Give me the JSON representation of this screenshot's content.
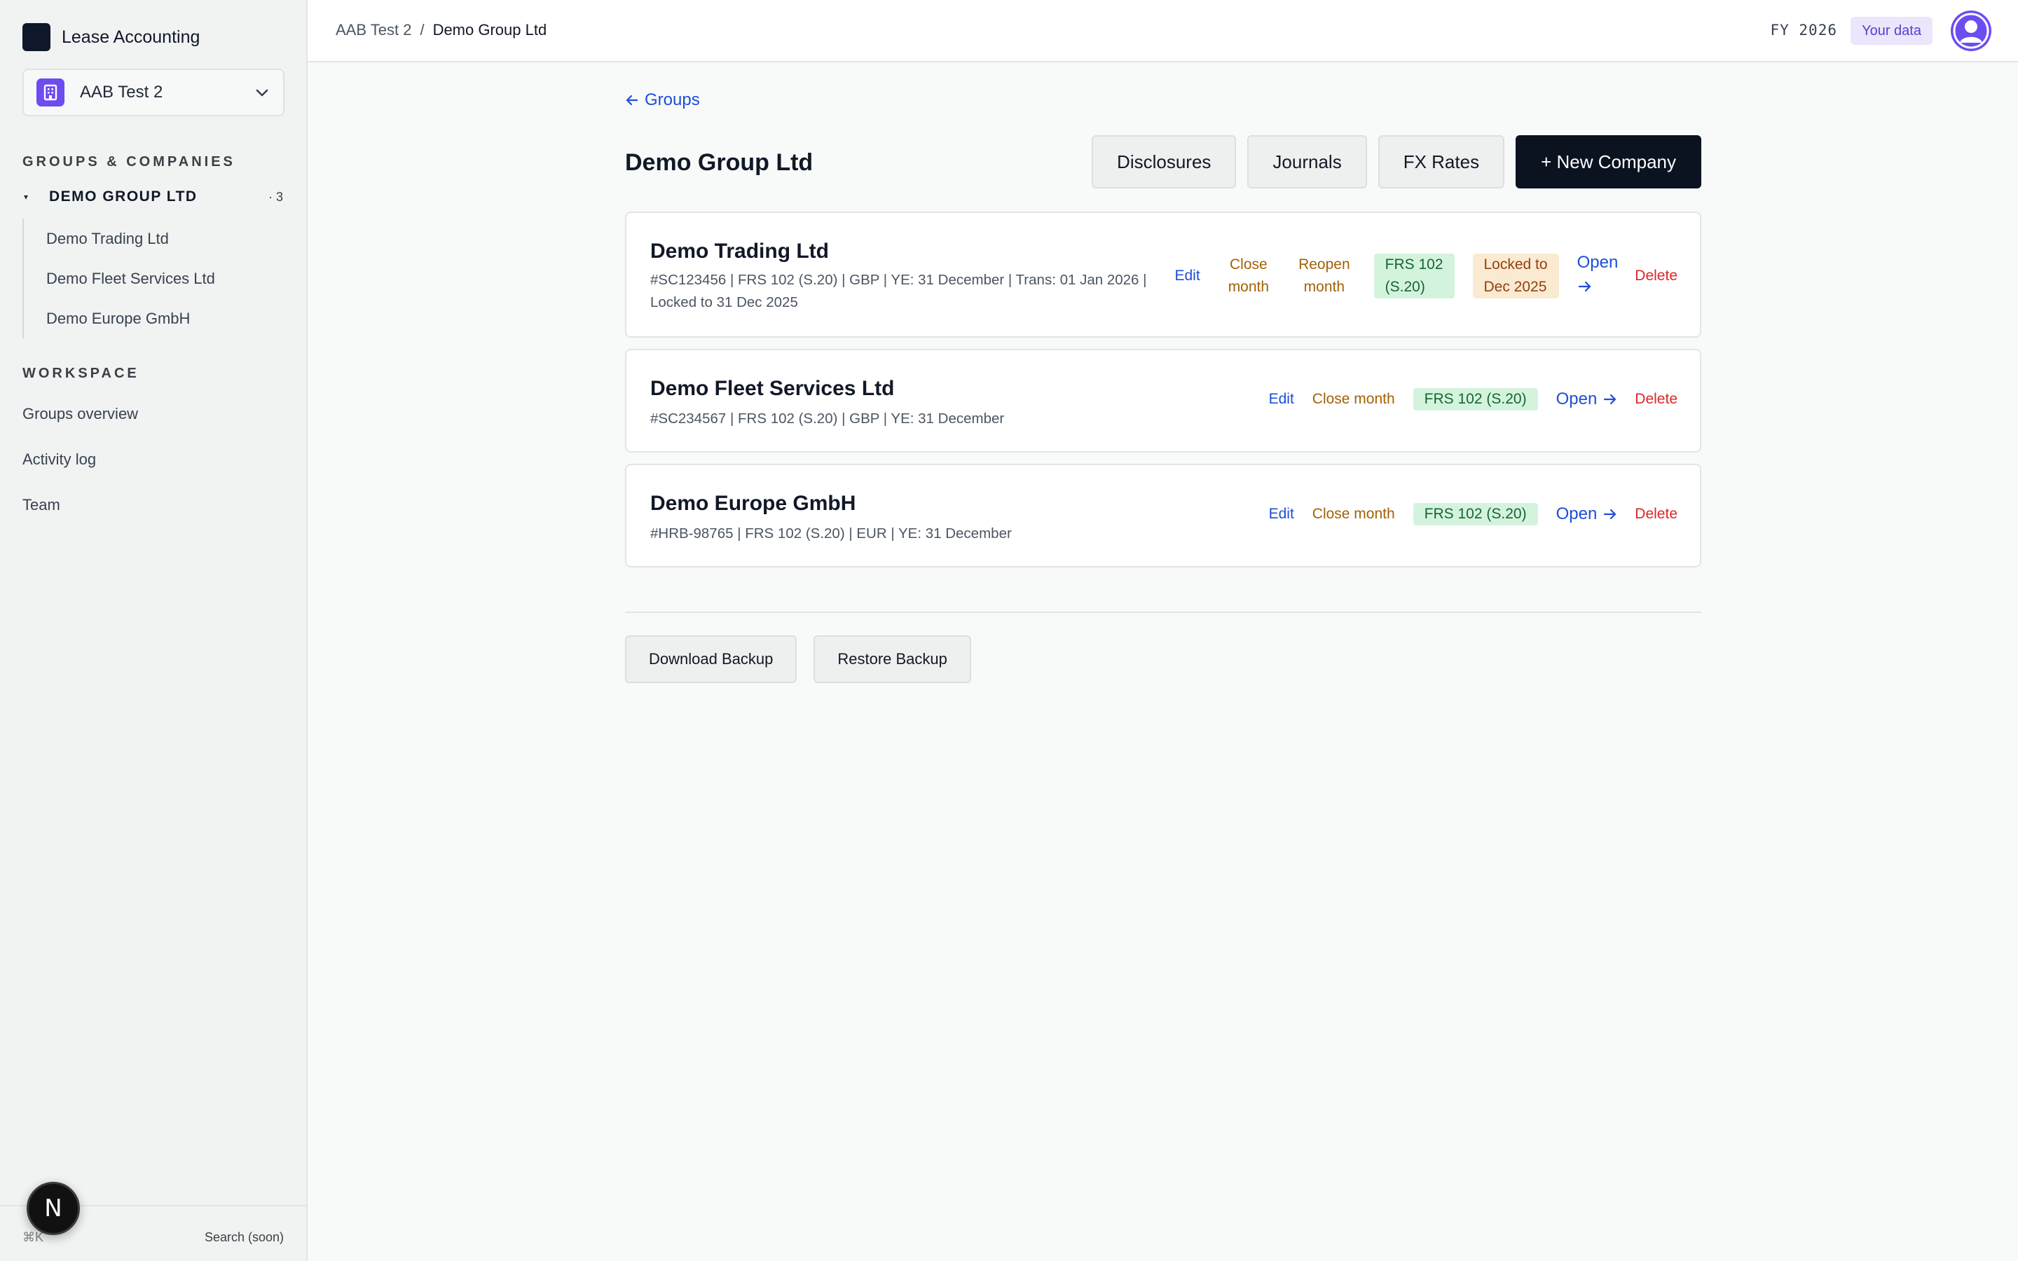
{
  "app": {
    "name": "Lease Accounting"
  },
  "org": {
    "name": "AAB Test 2"
  },
  "sidebar": {
    "groups_label": "GROUPS & COMPANIES",
    "group": {
      "name": "DEMO GROUP LTD",
      "count": "3"
    },
    "companies": [
      "Demo Trading Ltd",
      "Demo Fleet Services Ltd",
      "Demo Europe GmbH"
    ],
    "workspace_label": "WORKSPACE",
    "nav": [
      "Groups overview",
      "Activity log",
      "Team"
    ],
    "footer": {
      "shortcut": "⌘K",
      "search": "Search (soon)"
    },
    "badge": "N"
  },
  "topbar": {
    "breadcrumb": [
      "AAB Test 2",
      "/",
      "Demo Group Ltd"
    ],
    "fy": "FY 2026",
    "your_data": "Your data"
  },
  "main": {
    "back_label": "Groups",
    "title": "Demo Group Ltd",
    "actions": {
      "disclosures": "Disclosures",
      "journals": "Journals",
      "fx_rates": "FX Rates",
      "new_company": "+ New Company"
    },
    "companies": [
      {
        "name": "Demo Trading Ltd",
        "meta_line1": "#SC123456 | FRS 102 (S.20) | GBP | YE: 31 December | Trans: 01 Jan 2026 |",
        "meta_line2": "Locked to 31 Dec 2025",
        "edit": "Edit",
        "close_1": "Close",
        "close_2": "month",
        "reopen_1": "Reopen",
        "reopen_2": "month",
        "standard_1": "FRS 102",
        "standard_2": "(S.20)",
        "locked_1": "Locked to",
        "locked_2": "Dec 2025",
        "open": "Open",
        "delete": "Delete"
      },
      {
        "name": "Demo Fleet Services Ltd",
        "meta": "#SC234567 | FRS 102 (S.20) | GBP | YE: 31 December",
        "edit": "Edit",
        "close": "Close month",
        "standard": "FRS 102 (S.20)",
        "open": "Open",
        "delete": "Delete"
      },
      {
        "name": "Demo Europe GmbH",
        "meta": "#HRB-98765 | FRS 102 (S.20) | EUR | YE: 31 December",
        "edit": "Edit",
        "close": "Close month",
        "standard": "FRS 102 (S.20)",
        "open": "Open",
        "delete": "Delete"
      }
    ],
    "backup": {
      "download": "Download Backup",
      "restore": "Restore Backup"
    }
  },
  "colors": {
    "accent": "#6d4cf0",
    "link": "#1d4ed8",
    "danger": "#dc2626",
    "warning": "#a16207",
    "success_bg": "#d4f3dd",
    "primary_button": "#0b1220"
  },
  "icons": [
    "brand-square-icon",
    "building-icon",
    "chevron-down-icon",
    "arrow-left-icon",
    "arrow-right-icon",
    "user-avatar-icon"
  ]
}
